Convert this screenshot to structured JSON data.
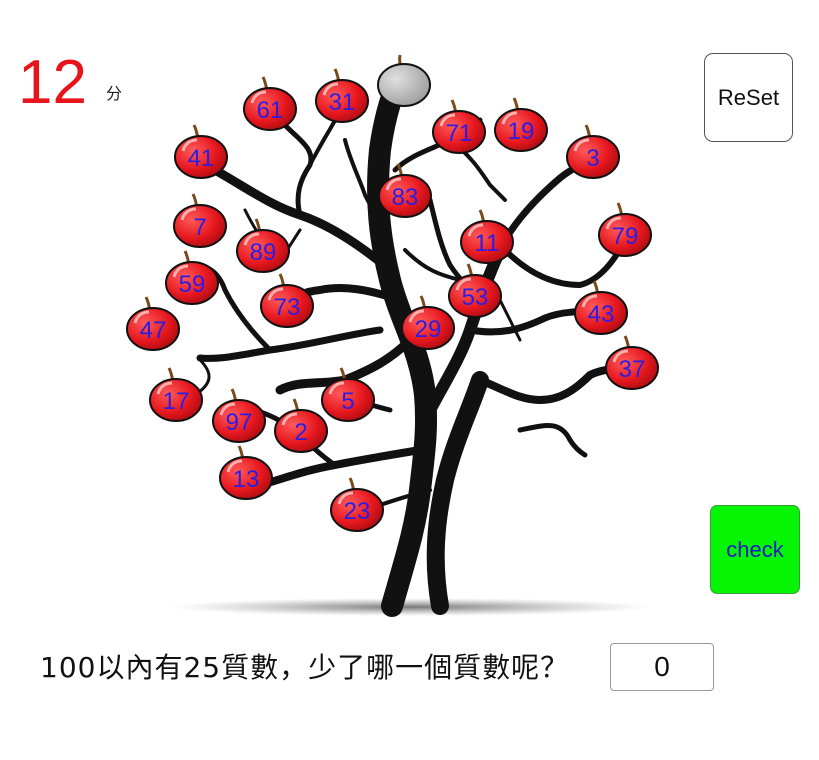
{
  "score": {
    "value": "12",
    "unit": "分"
  },
  "buttons": {
    "reset_label": "ReSet",
    "check_label": "check"
  },
  "question": {
    "text": "100以內有25質數，少了哪一個質數呢？"
  },
  "answer": {
    "value": "0"
  },
  "colors": {
    "score": "#e8141c",
    "apple": "#e6171e",
    "apple_number": "#2a1de6",
    "check_bg": "#05f505",
    "grey_apple": "#b5b5b5"
  },
  "apples": [
    {
      "n": "61"
    },
    {
      "n": "31"
    },
    {
      "n": "41"
    },
    {
      "n": "71"
    },
    {
      "n": "19"
    },
    {
      "n": "3"
    },
    {
      "n": "83"
    },
    {
      "n": "7"
    },
    {
      "n": "89"
    },
    {
      "n": "11"
    },
    {
      "n": "79"
    },
    {
      "n": "59"
    },
    {
      "n": "73"
    },
    {
      "n": "53"
    },
    {
      "n": "47"
    },
    {
      "n": "29"
    },
    {
      "n": "43"
    },
    {
      "n": "37"
    },
    {
      "n": "17"
    },
    {
      "n": "5"
    },
    {
      "n": "97"
    },
    {
      "n": "2"
    },
    {
      "n": "13"
    },
    {
      "n": "23"
    }
  ],
  "grey_apple": {
    "icon": "grey-apple-icon"
  }
}
